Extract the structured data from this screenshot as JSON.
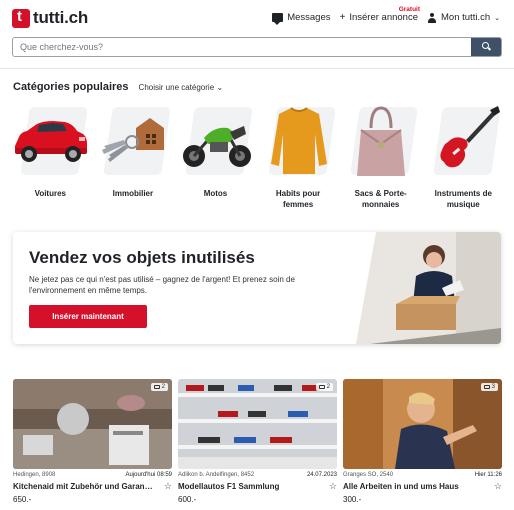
{
  "header": {
    "logo_text": "tutti.ch",
    "messages_label": "Messages",
    "insert_label": "Insérer annonce",
    "insert_badge": "Gratuit",
    "account_label": "Mon tutti.ch"
  },
  "search": {
    "placeholder": "Que cherchez-vous?"
  },
  "categories": {
    "title": "Catégories populaires",
    "choose_label": "Choisir une catégorie",
    "items": [
      {
        "label": "Voitures"
      },
      {
        "label": "Immobilier"
      },
      {
        "label": "Motos"
      },
      {
        "label": "Habits pour femmes"
      },
      {
        "label": "Sacs & Porte-monnaies"
      },
      {
        "label": "Instruments de musique"
      }
    ]
  },
  "banner": {
    "title": "Vendez vos objets inutilisés",
    "text": "Ne jetez pas ce qui n'est pas utilisé – gagnez de l'argent! Et prenez soin de l'environnement en même temps.",
    "button_label": "Insérer maintenant"
  },
  "listings": [
    {
      "location": "Hedingen, 8908",
      "date": "Aujourd'hui 08:59",
      "title": "Kitchenaid mit Zubehör und Garantie ...",
      "price": "650.-",
      "photos": "2"
    },
    {
      "location": "Adlikon b. Andelfingen, 8452",
      "date": "24.07.2023",
      "title": "Modellautos F1 Sammlung",
      "price": "600.-",
      "photos": "2"
    },
    {
      "location": "Granges SO, 2540",
      "date": "Hier 11:26",
      "title": "Alle Arbeiten in und ums Haus",
      "price": "300.-",
      "photos": "3"
    }
  ],
  "colors": {
    "brand_red": "#d5102a",
    "search_button": "#3e5169"
  }
}
